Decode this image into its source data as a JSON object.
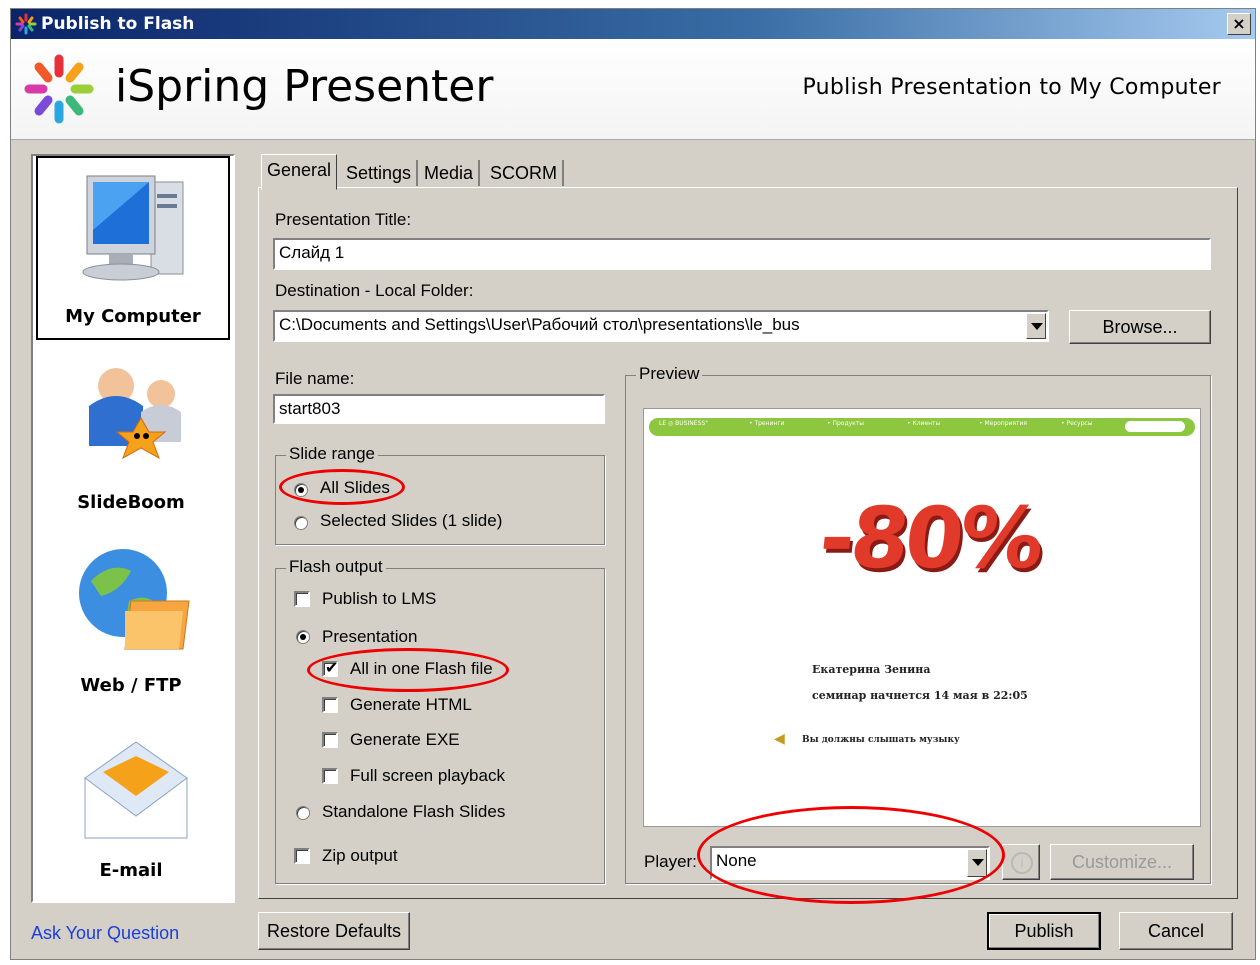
{
  "window": {
    "title": "Publish to Flash",
    "close_glyph": "×"
  },
  "header": {
    "brand": "iSpring Presenter",
    "subtitle": "Publish Presentation to My Computer"
  },
  "nav": {
    "items": [
      {
        "label": "My Computer",
        "icon": "computer-icon",
        "selected": true
      },
      {
        "label": "SlideBoom",
        "icon": "slideboom-icon",
        "selected": false
      },
      {
        "label": "Web / FTP",
        "icon": "globe-folder-icon",
        "selected": false
      },
      {
        "label": "E-mail",
        "icon": "envelope-icon",
        "selected": false
      }
    ],
    "ask_link": "Ask Your Question"
  },
  "tabs": [
    "General",
    "Settings",
    "Media",
    "SCORM"
  ],
  "general": {
    "title_label": "Presentation Title:",
    "title_value": "Слайд 1",
    "dest_label": "Destination - Local Folder:",
    "dest_value": "C:\\Documents and Settings\\User\\Рабочий стол\\presentations\\le_bus",
    "browse_label": "Browse...",
    "filename_label": "File name:",
    "filename_value": "start803",
    "slide_range": {
      "legend": "Slide range",
      "all": "All Slides",
      "selected": "Selected Slides (1 slide)"
    },
    "flash_output": {
      "legend": "Flash output",
      "publish_lms": "Publish to LMS",
      "presentation": "Presentation",
      "all_in_one": "All in one Flash file",
      "gen_html": "Generate HTML",
      "gen_exe": "Generate EXE",
      "full_screen": "Full screen playback",
      "standalone": "Standalone Flash Slides",
      "zip": "Zip output",
      "check_glyph": "✔"
    },
    "preview": {
      "legend": "Preview",
      "player_label": "Player:",
      "player_value": "None",
      "customize_label": "Customize...",
      "slide": {
        "nav_items": [
          "LE ◎ BUSINESS°",
          "• Тренинги",
          "• Продукты",
          "• Клиенты",
          "• Мероприятия",
          "• Ресурсы"
        ],
        "big_text": "-80%",
        "author": "Екатерина Зенина",
        "seminar": "семинар начнется 14 мая в 22:05",
        "music": "Вы должны слышать музыку"
      }
    }
  },
  "footer": {
    "restore": "Restore Defaults",
    "publish": "Publish",
    "cancel": "Cancel"
  },
  "colors": {
    "accent": "#0a246a",
    "annotation": "#e00000",
    "link": "#1b3fd8"
  }
}
